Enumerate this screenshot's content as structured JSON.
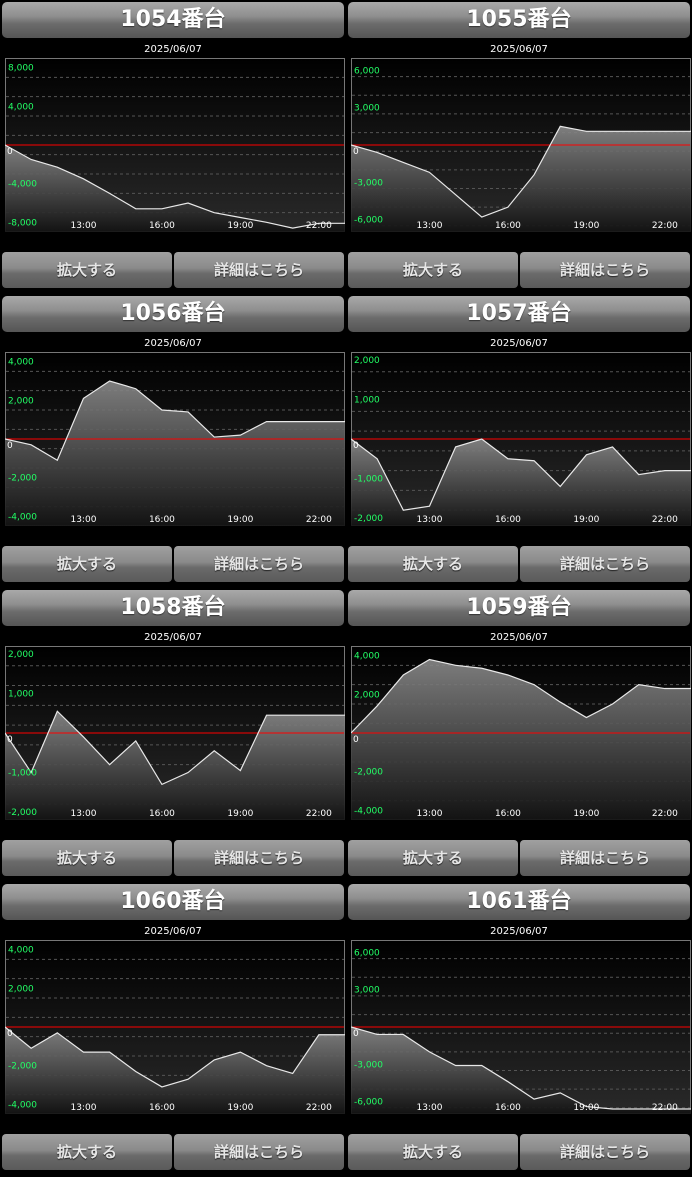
{
  "colors": {
    "accent_line": "#ff0000",
    "series_line": "#e8e8e8",
    "axis_label": "#22ff66"
  },
  "buttons": {
    "zoom_label": "拡大する",
    "detail_label": "詳細はこちら"
  },
  "chart_data": [
    {
      "type": "area",
      "title": "1054番台",
      "subtitle": "2025/06/07",
      "x": [
        "10:00",
        "11:00",
        "12:00",
        "13:00",
        "14:00",
        "15:00",
        "16:00",
        "17:00",
        "18:00",
        "19:00",
        "20:00",
        "21:00",
        "22:00",
        "23:00"
      ],
      "values": [
        0,
        -1500,
        -2300,
        -3500,
        -5000,
        -6600,
        -6600,
        -6000,
        -7000,
        -7500,
        -8000,
        -8600,
        -8100,
        -8100
      ],
      "ylim": [
        -9000,
        9000
      ],
      "yticks": [
        8000,
        4000,
        -4000,
        -8000
      ],
      "ytick_labels": [
        "8,000",
        "4,000",
        "-4,000",
        "-8,000"
      ],
      "xticks": [
        "13:00",
        "16:00",
        "19:00",
        "22:00"
      ]
    },
    {
      "type": "area",
      "title": "1055番台",
      "subtitle": "2025/06/07",
      "x": [
        "10:00",
        "11:00",
        "12:00",
        "13:00",
        "14:00",
        "15:00",
        "16:00",
        "17:00",
        "18:00",
        "19:00",
        "20:00",
        "21:00",
        "22:00",
        "23:00"
      ],
      "values": [
        0,
        -600,
        -1400,
        -2200,
        -4000,
        -5800,
        -5000,
        -2400,
        1500,
        1100,
        1100,
        1100,
        1100,
        1100
      ],
      "ylim": [
        -7000,
        7000
      ],
      "yticks": [
        6000,
        3000,
        -3000,
        -6000
      ],
      "ytick_labels": [
        "6,000",
        "3,000",
        "-3,000",
        "-6,000"
      ],
      "xticks": [
        "13:00",
        "16:00",
        "19:00",
        "22:00"
      ]
    },
    {
      "type": "area",
      "title": "1056番台",
      "subtitle": "2025/06/07",
      "x": [
        "10:00",
        "11:00",
        "12:00",
        "13:00",
        "14:00",
        "15:00",
        "16:00",
        "17:00",
        "18:00",
        "19:00",
        "20:00",
        "21:00",
        "22:00",
        "23:00"
      ],
      "values": [
        0,
        -300,
        -1100,
        2100,
        3000,
        2600,
        1500,
        1400,
        100,
        200,
        900,
        900,
        900,
        900
      ],
      "ylim": [
        -4500,
        4500
      ],
      "yticks": [
        4000,
        2000,
        -2000,
        -4000
      ],
      "ytick_labels": [
        "4,000",
        "2,000",
        "-2,000",
        "-4,000"
      ],
      "xticks": [
        "13:00",
        "16:00",
        "19:00",
        "22:00"
      ]
    },
    {
      "type": "area",
      "title": "1057番台",
      "subtitle": "2025/06/07",
      "x": [
        "10:00",
        "11:00",
        "12:00",
        "13:00",
        "14:00",
        "15:00",
        "16:00",
        "17:00",
        "18:00",
        "19:00",
        "20:00",
        "21:00",
        "22:00",
        "23:00"
      ],
      "values": [
        0,
        -500,
        -1800,
        -1700,
        -200,
        0,
        -500,
        -550,
        -1200,
        -400,
        -200,
        -900,
        -800,
        -800
      ],
      "ylim": [
        -2200,
        2200
      ],
      "yticks": [
        2000,
        1000,
        -1000,
        -2000
      ],
      "ytick_labels": [
        "2,000",
        "1,000",
        "-1,000",
        "-2,000"
      ],
      "xticks": [
        "13:00",
        "16:00",
        "19:00",
        "22:00"
      ]
    },
    {
      "type": "area",
      "title": "1058番台",
      "subtitle": "2025/06/07",
      "x": [
        "10:00",
        "11:00",
        "12:00",
        "13:00",
        "14:00",
        "15:00",
        "16:00",
        "17:00",
        "18:00",
        "19:00",
        "20:00",
        "21:00",
        "22:00",
        "23:00"
      ],
      "values": [
        0,
        -1000,
        550,
        -100,
        -800,
        -200,
        -1300,
        -1000,
        -450,
        -950,
        450,
        450,
        450,
        450
      ],
      "ylim": [
        -2200,
        2200
      ],
      "yticks": [
        2000,
        1000,
        -1000,
        -2000
      ],
      "ytick_labels": [
        "2,000",
        "1,000",
        "-1,000",
        "-2,000"
      ],
      "xticks": [
        "13:00",
        "16:00",
        "19:00",
        "22:00"
      ]
    },
    {
      "type": "area",
      "title": "1059番台",
      "subtitle": "2025/06/07",
      "x": [
        "10:00",
        "11:00",
        "12:00",
        "13:00",
        "14:00",
        "15:00",
        "16:00",
        "17:00",
        "18:00",
        "19:00",
        "20:00",
        "21:00",
        "22:00",
        "23:00"
      ],
      "values": [
        0,
        1400,
        3000,
        3800,
        3500,
        3350,
        3000,
        2500,
        1600,
        800,
        1500,
        2500,
        2300,
        2300
      ],
      "ylim": [
        -4500,
        4500
      ],
      "yticks": [
        4000,
        2000,
        -2000,
        -4000
      ],
      "ytick_labels": [
        "4,000",
        "2,000",
        "-2,000",
        "-4,000"
      ],
      "xticks": [
        "13:00",
        "16:00",
        "19:00",
        "22:00"
      ]
    },
    {
      "type": "area",
      "title": "1060番台",
      "subtitle": "2025/06/07",
      "x": [
        "10:00",
        "11:00",
        "12:00",
        "13:00",
        "14:00",
        "15:00",
        "16:00",
        "17:00",
        "18:00",
        "19:00",
        "20:00",
        "21:00",
        "22:00",
        "23:00"
      ],
      "values": [
        0,
        -1100,
        -300,
        -1300,
        -1300,
        -2300,
        -3100,
        -2700,
        -1700,
        -1300,
        -2000,
        -2400,
        -400,
        -400
      ],
      "ylim": [
        -4500,
        4500
      ],
      "yticks": [
        4000,
        2000,
        -2000,
        -4000
      ],
      "ytick_labels": [
        "4,000",
        "2,000",
        "-2,000",
        "-4,000"
      ],
      "xticks": [
        "13:00",
        "16:00",
        "19:00",
        "22:00"
      ]
    },
    {
      "type": "area",
      "title": "1061番台",
      "subtitle": "2025/06/07",
      "x": [
        "10:00",
        "11:00",
        "12:00",
        "13:00",
        "14:00",
        "15:00",
        "16:00",
        "17:00",
        "18:00",
        "19:00",
        "20:00",
        "21:00",
        "22:00",
        "23:00"
      ],
      "values": [
        0,
        -600,
        -600,
        -2000,
        -3100,
        -3100,
        -4400,
        -5800,
        -5300,
        -6400,
        -6600,
        -6600,
        -6600,
        -6600
      ],
      "ylim": [
        -7000,
        7000
      ],
      "yticks": [
        6000,
        3000,
        -3000,
        -6000
      ],
      "ytick_labels": [
        "6,000",
        "3,000",
        "-3,000",
        "-6,000"
      ],
      "xticks": [
        "13:00",
        "16:00",
        "19:00",
        "22:00"
      ]
    }
  ]
}
